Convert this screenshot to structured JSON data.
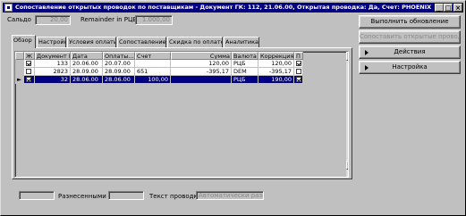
{
  "window": {
    "title": "Сопоставление открытых проводок по поставщикам - Документ ГК: 112, 21.06.00, Открытая проводка: Да, Счет: PHOENIX",
    "minimize": "_",
    "maximize": "□",
    "close": "×"
  },
  "header": {
    "balance_label": "Сальдо",
    "balance_value": "20,00",
    "remainder_label": "Remainder in РЦБ",
    "remainder_value": "1.000,00"
  },
  "buttons": {
    "update": "Выполнить обновление",
    "disabled_action": "Сопоставить открытые проводки",
    "actions": "Действия",
    "settings": "Настройка"
  },
  "tabs": [
    {
      "label": "Обзор",
      "active": true
    },
    {
      "label": "Настройки",
      "active": false
    },
    {
      "label": "Условия оплаты",
      "active": false
    },
    {
      "label": "Сопоставление",
      "active": false
    },
    {
      "label": "Скидка по оплате",
      "active": false
    },
    {
      "label": "Аналитика",
      "active": false
    }
  ],
  "table": {
    "columns": [
      "Ж",
      "Документ ГК",
      "Дата",
      "Оплаты...",
      "Счет",
      "Сумма",
      "Валюта",
      "Коррекция",
      "П"
    ],
    "rows": [
      {
        "marker": "",
        "mark": true,
        "doc": "133",
        "date": "20.06.00",
        "due": "20.07.00",
        "invoice": "",
        "amount": "120,00",
        "currency": "РЦБ",
        "correction": "120,00",
        "p": true,
        "selected": false
      },
      {
        "marker": "",
        "mark": false,
        "doc": "2823",
        "date": "28.09.00",
        "due": "28.09.00",
        "invoice": "651",
        "amount": "-395,17",
        "currency": "DEM",
        "correction": "-395,17",
        "p": false,
        "selected": false
      },
      {
        "marker": "►",
        "mark": true,
        "doc": "32",
        "date": "28.06.00",
        "due": "28.06.00",
        "invoice": "100,00",
        "amount": "",
        "currency": "РЦБ",
        "correction": "190,00",
        "p": true,
        "selected": true
      }
    ]
  },
  "footer": {
    "diff_label": "Разнесенными",
    "text_label": "Текст проводки",
    "disabled_field": "Автоматически разнесено"
  }
}
